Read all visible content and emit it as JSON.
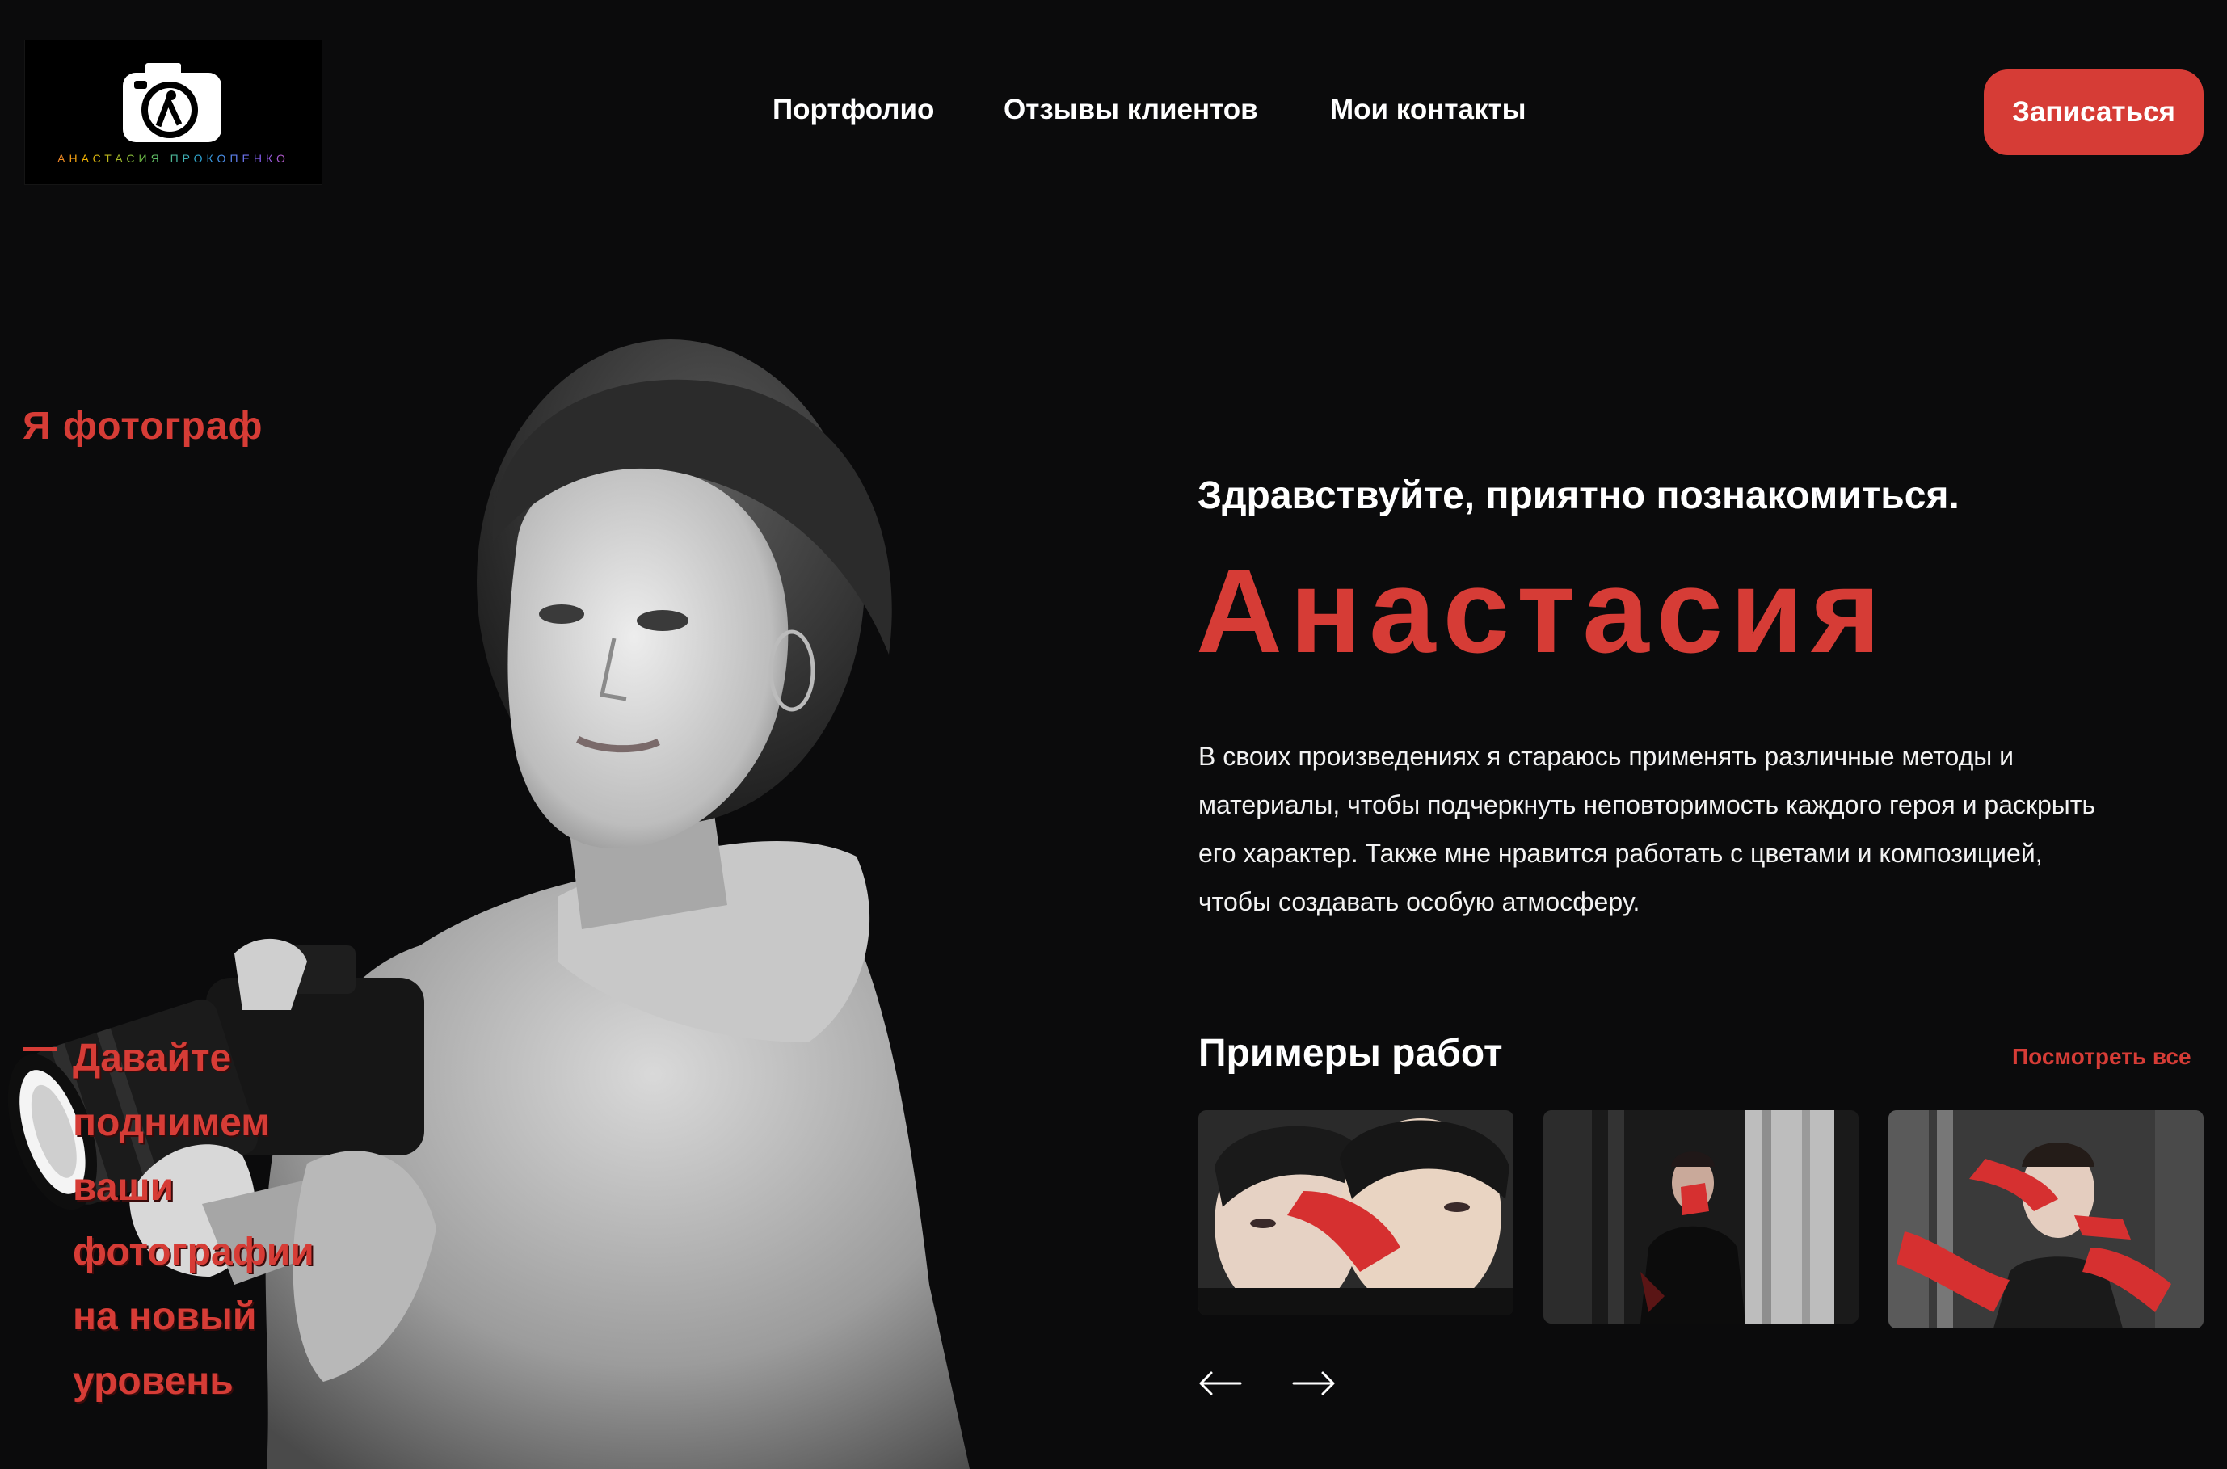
{
  "logo": {
    "text": "АНАСТАСИЯ ПРОКОПЕНКО",
    "icon": "camera-logo-icon"
  },
  "nav": {
    "items": [
      {
        "label": "Портфолио"
      },
      {
        "label": "Отзывы клиентов"
      },
      {
        "label": "Мои контакты"
      }
    ]
  },
  "cta": {
    "label": "Записаться"
  },
  "hero": {
    "tagline": "Я фотограф",
    "slogan_lines": "Давайте\nподнимем\nваши\nфотографии\nна новый\nуровень",
    "greeting": "Здравствуйте, приятно познакомиться.",
    "name": "Анастасия",
    "about": "В своих произведениях я стараюсь применять различные методы и материалы, чтобы подчеркнуть неповторимость каждого героя и раскрыть его характер. Также мне нравится работать с цветами и композицией, чтобы создавать особую атмосферу."
  },
  "works": {
    "title": "Примеры работ",
    "see_all": "Посмотреть все",
    "cards": [
      {
        "subject": "two-faces-red-paint"
      },
      {
        "subject": "man-in-forest-red-hand"
      },
      {
        "subject": "man-with-red-hands"
      }
    ],
    "prev_icon": "arrow-left-icon",
    "next_icon": "arrow-right-icon"
  },
  "colors": {
    "background": "#0b0b0c",
    "accent": "#d63c36",
    "text": "#ffffff"
  }
}
